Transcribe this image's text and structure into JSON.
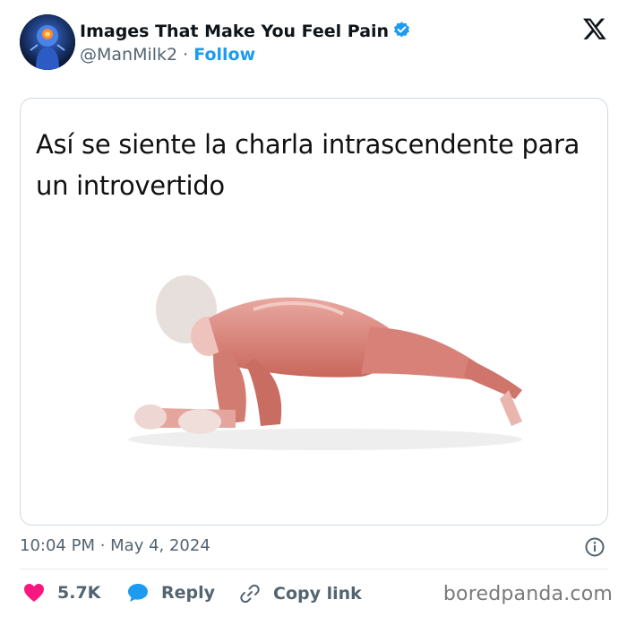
{
  "author": {
    "display_name": "Images That Make You Feel Pain",
    "handle": "@ManMilk2",
    "separator": "·",
    "follow_label": "Follow",
    "verified_color": "#1d9bf0"
  },
  "post": {
    "caption": "Así se siente la charla intrascendente para un introvertido",
    "timestamp": "10:04 PM · May 4, 2024"
  },
  "actions": {
    "like_count": "5.7K",
    "reply_label": "Reply",
    "copy_label": "Copy link"
  },
  "icons": [
    "verified-badge-icon",
    "x-logo-icon",
    "info-icon",
    "heart-icon",
    "reply-bubble-icon",
    "link-icon"
  ],
  "watermark": "boredpanda.com",
  "colors": {
    "accent": "#1d9bf0",
    "like": "#f91880",
    "muted": "#536471"
  }
}
